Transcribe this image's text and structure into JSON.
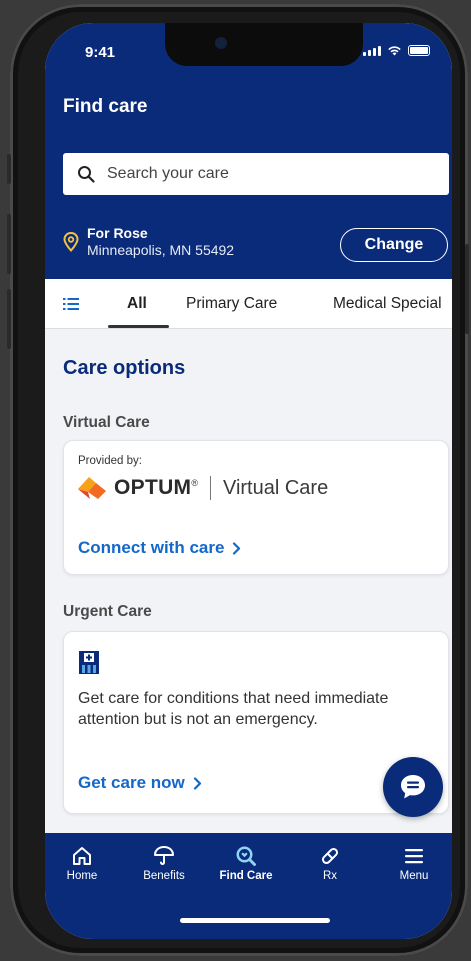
{
  "status_bar": {
    "time": "9:41"
  },
  "header": {
    "title": "Find care"
  },
  "search": {
    "placeholder": "Search your care"
  },
  "location": {
    "name": "For Rose",
    "address": "Minneapolis, MN 55492",
    "change_label": "Change"
  },
  "tabs": [
    {
      "label": "All",
      "active": true
    },
    {
      "label": "Primary Care"
    },
    {
      "label": "Medical Special"
    }
  ],
  "care_options": {
    "title": "Care options",
    "virtual": {
      "heading": "Virtual Care",
      "provided_by": "Provided by:",
      "logo_text": "OPTUM",
      "logo_reg": "®",
      "logo_suffix": "Virtual Care",
      "link": "Connect with care"
    },
    "urgent": {
      "heading": "Urgent Care",
      "icon": "hospital-icon",
      "description": "Get care for conditions that need immediate attention but is not an emergency.",
      "link": "Get care now"
    }
  },
  "bottom_nav": [
    {
      "label": "Home",
      "icon": "home-icon"
    },
    {
      "label": "Benefits",
      "icon": "umbrella-icon"
    },
    {
      "label": "Find Care",
      "icon": "search-heart-icon",
      "active": true
    },
    {
      "label": "Rx",
      "icon": "pill-icon"
    },
    {
      "label": "Menu",
      "icon": "menu-icon"
    }
  ],
  "colors": {
    "brand_navy": "#0a2b7a",
    "link_blue": "#1468c8",
    "pin_yellow": "#f5c242",
    "optum_orange": "#f26b21"
  }
}
